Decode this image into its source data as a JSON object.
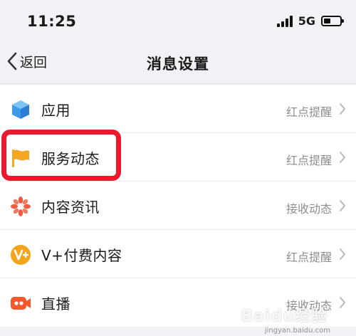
{
  "status_bar": {
    "time": "11:25",
    "network": "5G",
    "battery_level": 0.45
  },
  "nav": {
    "back_label": "返回",
    "title": "消息设置"
  },
  "items": [
    {
      "label": "应用",
      "value": "红点提醒",
      "icon": "cube-icon",
      "color": "#3d9ae8"
    },
    {
      "label": "服务动态",
      "value": "红点提醒",
      "icon": "flag-icon",
      "color": "#f5a623"
    },
    {
      "label": "内容资讯",
      "value": "接收动态",
      "icon": "pinwheel-icon",
      "color": "#ef5b3f"
    },
    {
      "label": "V+付费内容",
      "value": "红点提醒",
      "icon": "vplus-icon",
      "color": "#f4a31a"
    },
    {
      "label": "直播",
      "value": "接收动态",
      "icon": "live-camera-icon",
      "color": "#f25a2c"
    }
  ],
  "watermark": {
    "brand": "Baidu经验",
    "url": "jingyan.baidu.com"
  },
  "colors": {
    "highlight": "#ea1a2c",
    "secondary_text": "#8e8e93"
  }
}
